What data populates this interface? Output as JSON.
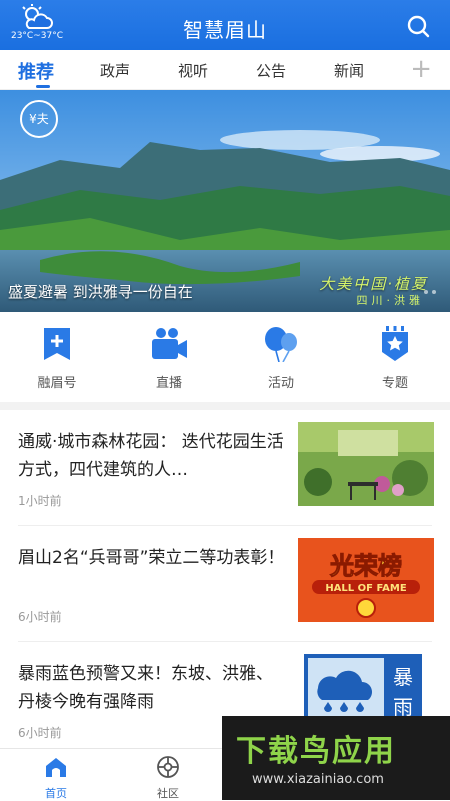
{
  "header": {
    "weather_icon": "partly-cloudy-icon",
    "temperature": "23°C~37°C",
    "title": "智慧眉山",
    "search_icon": "search-icon"
  },
  "tabs": [
    {
      "label": "推荐",
      "active": true
    },
    {
      "label": "政声",
      "active": false
    },
    {
      "label": "视听",
      "active": false
    },
    {
      "label": "公告",
      "active": false
    },
    {
      "label": "新闻",
      "active": false
    }
  ],
  "add_tab_icon": "plus-icon",
  "banner": {
    "caption": "盛夏避暑 到洪雅寻一份自在",
    "stamp": "¥夫",
    "sign_line1": "大美中国·植夏",
    "sign_line2": "四川·洪雅"
  },
  "quick_links": [
    {
      "label": "融眉号",
      "icon": "bookmark-plus-icon"
    },
    {
      "label": "直播",
      "icon": "video-camera-icon"
    },
    {
      "label": "活动",
      "icon": "balloons-icon"
    },
    {
      "label": "专题",
      "icon": "star-badge-icon"
    }
  ],
  "news": [
    {
      "title": "通威·城市森林花园： 迭代花园生活方式，四代建筑的人…",
      "time": "1小时前",
      "thumb": "garden-photo"
    },
    {
      "title": "眉山2名“兵哥哥”荣立二等功表彰！",
      "time": "6小时前",
      "thumb": "hall-of-fame-photo",
      "thumb_text1": "光荣榜",
      "thumb_text2": "HALL OF FAME"
    },
    {
      "title": "暴雨蓝色预警又来！东坡、洪雅、丹棱今晚有强降雨",
      "time": "6小时前",
      "thumb": "rain-warning-photo",
      "thumb_text1": "暴",
      "thumb_text2": "雨"
    }
  ],
  "bottom_nav": [
    {
      "label": "首页",
      "icon": "home-icon",
      "active": true
    },
    {
      "label": "社区",
      "icon": "community-icon",
      "active": false
    }
  ],
  "watermark": {
    "brand": "下载鸟应用",
    "url": "www.xiazainiao.com"
  },
  "colors": {
    "primary": "#1f6fe0",
    "accent_blue": "#2a7ae6"
  }
}
